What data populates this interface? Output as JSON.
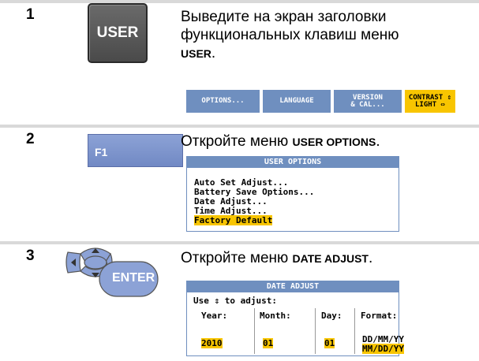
{
  "steps": [
    {
      "num": "1",
      "text_pre": "Выведите на экран заголовки функциональных клавиш меню ",
      "text_bold": "USER",
      "text_post": "."
    },
    {
      "num": "2",
      "text_pre": "Откройте меню ",
      "text_bold": "USER OPTIONS",
      "text_post": "."
    },
    {
      "num": "3",
      "text_pre": "Откройте меню ",
      "text_bold": "DATE ADJUST",
      "text_post": "."
    }
  ],
  "keys": {
    "user": "USER",
    "f1": "F1",
    "enter": "ENTER"
  },
  "softkeys": [
    {
      "line1": "OPTIONS...",
      "line2": ""
    },
    {
      "line1": "LANGUAGE",
      "line2": ""
    },
    {
      "line1": "VERSION",
      "line2": "& CAL..."
    },
    {
      "line1": "CONTRAST ⇕",
      "line2": "LIGHT ⇔"
    }
  ],
  "user_options": {
    "title": "USER OPTIONS",
    "items": [
      "Auto Set Adjust...",
      "Battery Save Options...",
      "Date Adjust...",
      "Time Adjust...",
      "Factory Default"
    ],
    "selected_index": 4
  },
  "date_adjust": {
    "title": "DATE ADJUST",
    "hint": "Use ⇕ to adjust:",
    "headers": {
      "year": "Year:",
      "month": "Month:",
      "day": "Day:",
      "format": "Format:"
    },
    "values": {
      "year": "2010",
      "month": "01",
      "day": "01"
    },
    "formats": [
      "DD/MM/YY",
      "MM/DD/YY"
    ],
    "selected_format_index": 1
  },
  "colors": {
    "accent": "#6f8fbf",
    "highlight": "#f8c500",
    "step_bar": "#d9d9d9"
  }
}
